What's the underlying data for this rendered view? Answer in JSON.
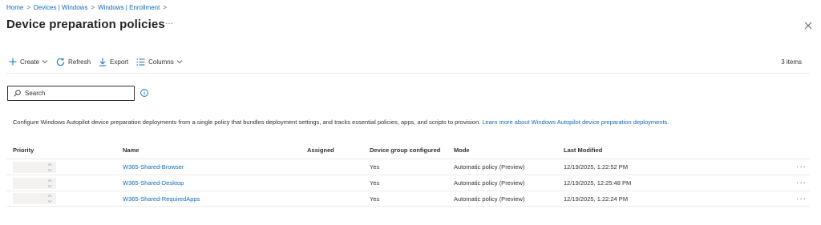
{
  "breadcrumb": {
    "items": [
      "Home",
      "Devices | Windows",
      "Windows | Enrollment"
    ],
    "separator": ">"
  },
  "title": "Device preparation policies",
  "title_more": "···",
  "toolbar": {
    "create": "Create",
    "refresh": "Refresh",
    "export": "Export",
    "columns": "Columns",
    "items_count": "3 items"
  },
  "search": {
    "placeholder": "Search"
  },
  "description": {
    "text": "Configure Windows Autopilot device preparation deployments from a single policy that bundles deployment settings, and tracks essential policies, apps, and scripts to provision.",
    "link": "Learn more about Windows Autopilot device preparation deployments."
  },
  "table": {
    "columns": [
      "Priority",
      "Name",
      "Assigned",
      "Device group configured",
      "Mode",
      "Last Modified"
    ],
    "rows": [
      {
        "name": "W365-Shared-Browser",
        "assigned": "",
        "device_group": "Yes",
        "mode": "Automatic policy (Preview)",
        "last_modified": "12/19/2025, 1:22:52 PM",
        "more": "···"
      },
      {
        "name": "W365-Shared-Desktop",
        "assigned": "",
        "device_group": "Yes",
        "mode": "Automatic policy (Preview)",
        "last_modified": "12/19/2025, 12:25:48 PM",
        "more": "···"
      },
      {
        "name": "W365-Shared-RequiredApps",
        "assigned": "",
        "device_group": "Yes",
        "mode": "Automatic policy (Preview)",
        "last_modified": "12/19/2025, 1:22:24 PM",
        "more": "···"
      }
    ]
  },
  "colors": {
    "link": "#0f6cbd",
    "text": "#323130",
    "divider": "#edebe9",
    "spinner_bg": "#f3f2f1"
  }
}
